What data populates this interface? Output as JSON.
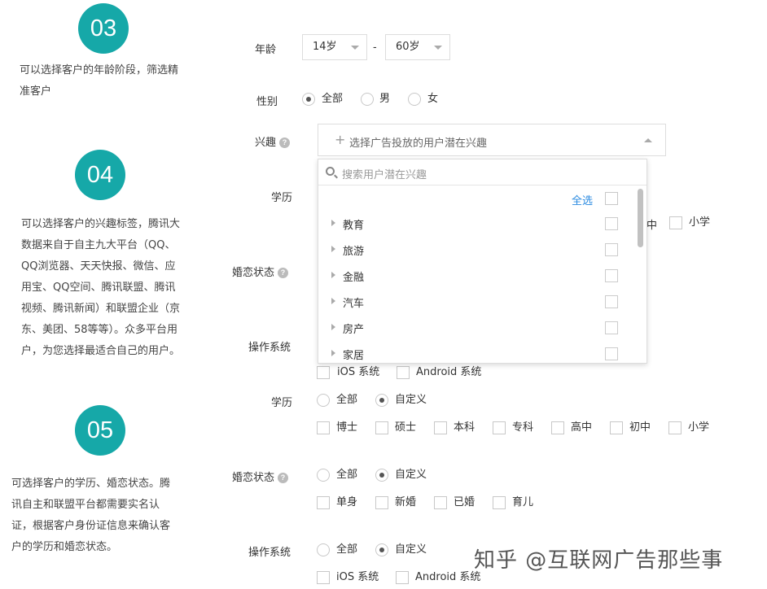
{
  "steps": {
    "s03": {
      "num": "03",
      "desc_l1": "可以选择客户的年龄阶段，筛选精",
      "desc_l2": "准客户"
    },
    "s04": {
      "num": "04",
      "desc_lines": [
        "可以选择客户的兴趣标签，腾讯大",
        "数据来自于自主九大平台（QQ、",
        "QQ浏览器、天天快报、微信、应",
        "用宝、QQ空间、腾讯联盟、腾讯",
        "视频、腾讯新闻）和联盟企业（京",
        "东、美团、58等等）。众多平台用",
        "户，为您选择最适合自己的用户。"
      ]
    },
    "s05": {
      "num": "05",
      "desc_lines": [
        "可选择客户的学历、婚恋状态。腾",
        "讯自主和联盟平台都需要实名认",
        "证，根据客户身份证信息来确认客",
        "户的学历和婚恋状态。"
      ]
    }
  },
  "age": {
    "label": "年龄",
    "min": "14岁",
    "sep": "-",
    "max": "60岁"
  },
  "gender": {
    "label": "性别",
    "options": [
      "全部",
      "男",
      "女"
    ],
    "selected": "全部"
  },
  "interest": {
    "label": "兴趣",
    "placeholder": "选择广告投放的用户潜在兴趣",
    "search_placeholder": "搜索用户潜在兴趣",
    "select_all": "全选",
    "items": [
      "教育",
      "旅游",
      "金融",
      "汽车",
      "房产",
      "家居"
    ]
  },
  "behind": {
    "edu_label": "学历",
    "marital_label": "婚恋状态",
    "os_label": "操作系统",
    "edu_cut": "中",
    "edu_last": "小学",
    "os_options": [
      "iOS 系统",
      "Android 系统"
    ]
  },
  "education": {
    "label": "学历",
    "modes": [
      "全部",
      "自定义"
    ],
    "selected": "自定义",
    "options": [
      "博士",
      "硕士",
      "本科",
      "专科",
      "高中",
      "初中",
      "小学"
    ]
  },
  "marital": {
    "label": "婚恋状态",
    "modes": [
      "全部",
      "自定义"
    ],
    "selected": "自定义",
    "options": [
      "单身",
      "新婚",
      "已婚",
      "育儿"
    ]
  },
  "os": {
    "label": "操作系统",
    "modes": [
      "全部",
      "自定义"
    ],
    "selected": "自定义",
    "options": [
      "iOS 系统",
      "Android 系统"
    ]
  },
  "watermark": "知乎 @互联网广告那些事",
  "colors": {
    "accent": "#16a8a8",
    "link": "#2a8ae0"
  }
}
